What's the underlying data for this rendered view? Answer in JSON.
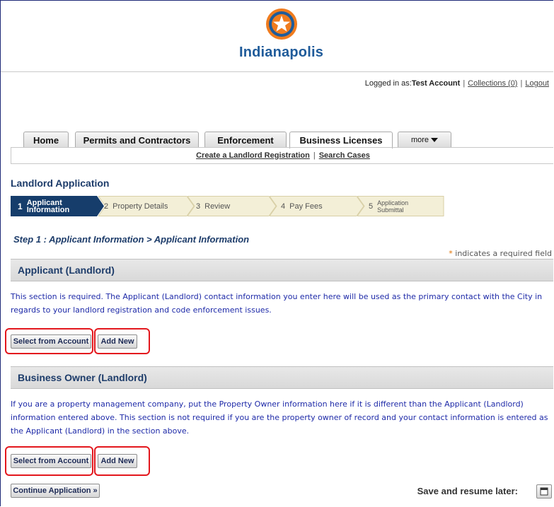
{
  "header": {
    "logo_text": "Indianapolis"
  },
  "login": {
    "prefix": "Logged in as:",
    "user": "Test Account",
    "collections": "Collections (0)",
    "logout": "Logout"
  },
  "tabs": [
    {
      "label": "Home"
    },
    {
      "label": "Permits and Contractors"
    },
    {
      "label": "Enforcement"
    },
    {
      "label": "Business Licenses"
    },
    {
      "label": "more"
    }
  ],
  "subnav": {
    "create": "Create a Landlord Registration",
    "search": "Search Cases"
  },
  "page_title": "Landlord Application",
  "steps": [
    {
      "num": "1",
      "label": "Applicant Information",
      "line1": "Applicant",
      "line2": "Information"
    },
    {
      "num": "2",
      "label": "Property Details"
    },
    {
      "num": "3",
      "label": "Review"
    },
    {
      "num": "4",
      "label": "Pay Fees"
    },
    {
      "num": "5",
      "label": "Application Submittal",
      "line1": "Application",
      "line2": "Submittal"
    }
  ],
  "step_heading": "Step 1 : Applicant Information > Applicant Information",
  "required_note": {
    "star": "*",
    "text": " indicates a required field"
  },
  "applicant": {
    "title": "Applicant (Landlord)",
    "info": "This section is required. The Applicant (Landlord) contact information you enter here will be used as the primary contact with the City in regards to your landlord registration and code enforcement issues.",
    "select_label": "Select from Account",
    "add_label": "Add New"
  },
  "owner": {
    "title": "Business Owner (Landlord)",
    "info": "If you are a property management company, put the Property Owner information here if it is different than the Applicant (Landlord) information entered above. This section is not required if you are the property owner of record and your contact information is entered as the Applicant (Landlord) in the section above.",
    "select_label": "Select from Account",
    "add_label": "Add New"
  },
  "footer": {
    "continue_label": "Continue Application »",
    "save_later_label": "Save and resume later:"
  },
  "colors": {
    "active_step": "#163d6b",
    "inactive_step": "#f3efd7",
    "highlight": "#e3171d",
    "info_text": "#1e2aa8",
    "logo_orange": "#f07c1e"
  }
}
